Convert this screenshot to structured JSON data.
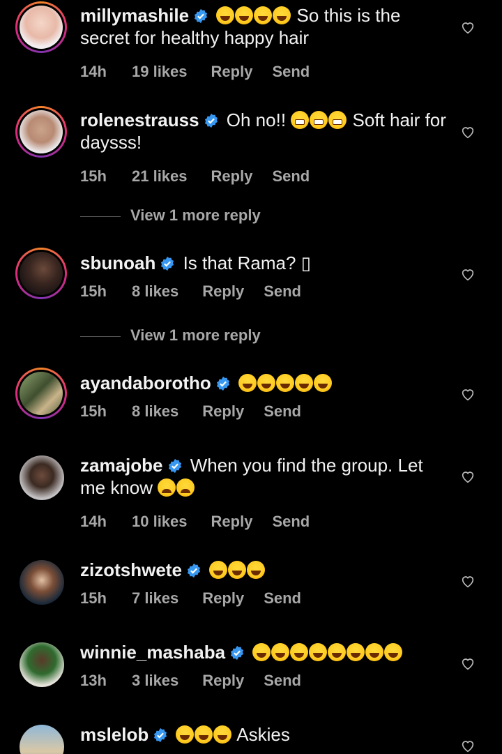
{
  "comments": [
    {
      "username": "millymashile",
      "text": "So this is the secret for healthy happy hair",
      "emojis": [
        "grin",
        "grin",
        "grin",
        "grin"
      ],
      "time": "14h",
      "likes": "19 likes",
      "reply": "Reply",
      "send": "Send",
      "verified": true
    },
    {
      "username": "rolenestrauss",
      "text": "Oh no!!",
      "text2": "Soft hair for daysss!",
      "emojis": [
        "grimace",
        "grimace",
        "grimace"
      ],
      "time": "15h",
      "likes": "21 likes",
      "reply": "Reply",
      "send": "Send",
      "verified": true
    },
    {
      "username": "sbunoah",
      "text": "Is that Rama? ▯",
      "time": "15h",
      "likes": "8 likes",
      "reply": "Reply",
      "send": "Send",
      "verified": true
    },
    {
      "username": "ayandaborotho",
      "text": "",
      "emojis": [
        "joy",
        "joy",
        "joy",
        "joy",
        "joy"
      ],
      "time": "15h",
      "likes": "8 likes",
      "reply": "Reply",
      "send": "Send",
      "verified": true
    },
    {
      "username": "zamajobe",
      "text": "When you find the group. Let me know",
      "emojis": [
        "weary",
        "weary"
      ],
      "time": "14h",
      "likes": "10 likes",
      "reply": "Reply",
      "send": "Send",
      "verified": true
    },
    {
      "username": "zizotshwete",
      "text": "",
      "emojis": [
        "grin",
        "grin",
        "grin"
      ],
      "time": "15h",
      "likes": "7 likes",
      "reply": "Reply",
      "send": "Send",
      "verified": true
    },
    {
      "username": "winnie_mashaba",
      "text": "",
      "emojis": [
        "rofl",
        "rofl",
        "rofl",
        "rofl",
        "rofl",
        "rofl",
        "rofl",
        "rofl"
      ],
      "time": "13h",
      "likes": "3 likes",
      "reply": "Reply",
      "send": "Send",
      "verified": true
    },
    {
      "username": "mslelob",
      "text": "Askies",
      "emojis": [
        "grin",
        "grin",
        "grin"
      ],
      "verified": true
    }
  ],
  "view_more_1": "View 1 more reply",
  "view_more_2": "View 1 more reply",
  "colors": {
    "verified": "#3897f0",
    "meta": "#a8a8a8",
    "background": "#000000"
  }
}
